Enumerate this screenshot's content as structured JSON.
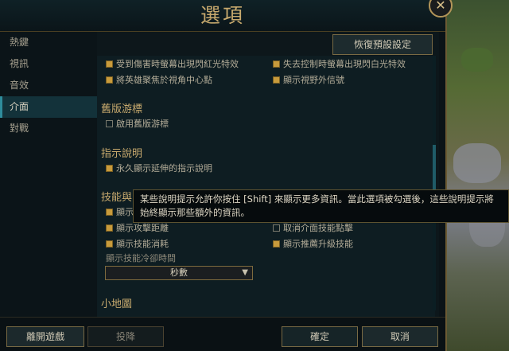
{
  "window": {
    "title": "選項",
    "close_icon": "✕"
  },
  "sidebar": {
    "items": [
      {
        "label": "熱鍵",
        "active": false
      },
      {
        "label": "視訊",
        "active": false
      },
      {
        "label": "音效",
        "active": false
      },
      {
        "label": "介面",
        "active": true
      },
      {
        "label": "對戰",
        "active": false
      }
    ]
  },
  "content": {
    "reset_label": "恢復預設設定",
    "options_top": [
      {
        "label": "受到傷害時螢幕出現閃紅光特效",
        "checked": true
      },
      {
        "label": "失去控制時螢幕出現閃白光特效",
        "checked": true
      },
      {
        "label": "將英雄聚焦於視角中心點",
        "checked": true
      },
      {
        "label": "顯示視野外信號",
        "checked": true
      }
    ],
    "legacy_cursor": {
      "title": "舊版游標",
      "option": {
        "label": "啟用舊版游標",
        "checked": false
      }
    },
    "tooltips": {
      "title": "指示說明",
      "option": {
        "label": "永久顯示延伸的指示說明",
        "checked": true
      }
    },
    "ability": {
      "title": "技能與",
      "options": [
        {
          "label": "顯示",
          "checked": true
        },
        {
          "label": "顯示攻擊距離",
          "checked": true
        },
        {
          "label": "取消介面技能點擊",
          "checked": false
        },
        {
          "label": "顯示技能消耗",
          "checked": true
        },
        {
          "label": "顯示推薦升級技能",
          "checked": true
        }
      ],
      "cooldown_label": "顯示技能冷卻時間",
      "cooldown_value": "秒數"
    },
    "minimap": {
      "title": "小地圖"
    }
  },
  "tooltip": {
    "text": "某些說明提示允許你按住 [Shift] 來顯示更多資訊。當此選項被勾選後，這些說明提示將始終顯示那些額外的資訊。"
  },
  "footer": {
    "exit_label": "離開遊戲",
    "surrender_label": "投降",
    "ok_label": "確定",
    "cancel_label": "取消"
  },
  "colors": {
    "accent_gold": "#c8aa6e",
    "checkbox_on": "#c89b3c",
    "active_tab": "#13323a"
  }
}
